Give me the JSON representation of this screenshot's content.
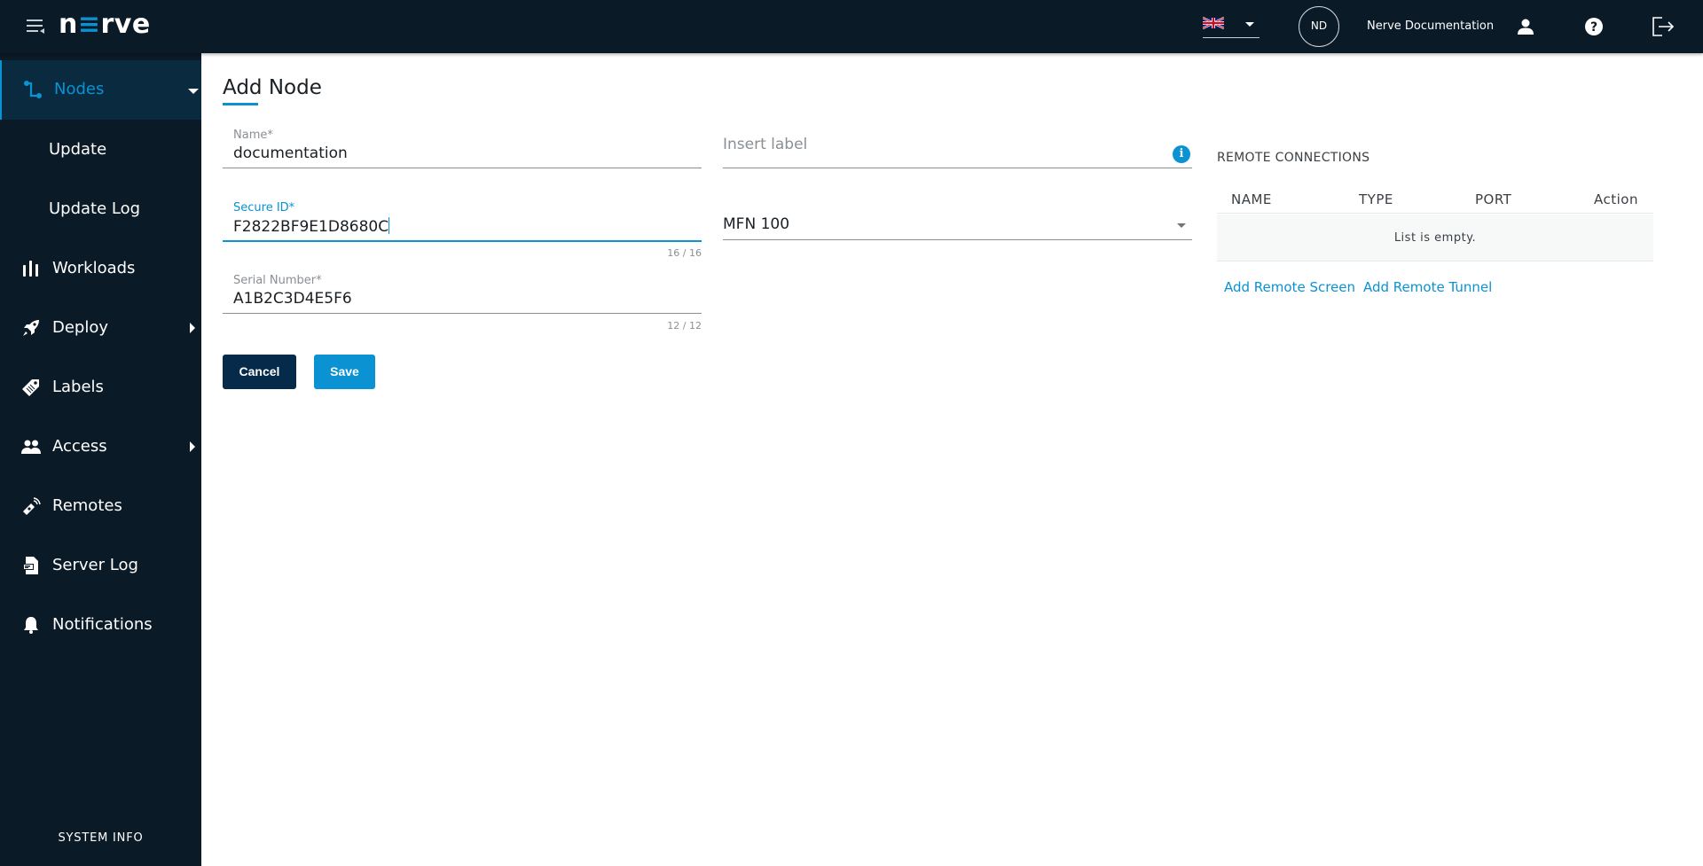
{
  "app": {
    "logo_prefix": "n",
    "logo_accent": "≡",
    "logo_suffix": "rve",
    "brand_color": "#0a92d2",
    "dark_color": "#0b1a27"
  },
  "topbar": {
    "language": "English (UK)",
    "avatar_initials": "ND",
    "username": "Nerve Documentation",
    "icons": [
      "menu-collapse-icon",
      "uk-flag-icon",
      "user-icon",
      "help-icon",
      "logout-icon"
    ]
  },
  "sidebar": {
    "items": [
      {
        "label": "Nodes",
        "icon": "nodes-icon",
        "active": true,
        "expandable": "down"
      },
      {
        "label": "Update",
        "sub": true
      },
      {
        "label": "Update Log",
        "sub": true
      },
      {
        "label": "Workloads",
        "icon": "workloads-icon"
      },
      {
        "label": "Deploy",
        "icon": "rocket-icon",
        "expandable": "right"
      },
      {
        "label": "Labels",
        "icon": "tag-icon"
      },
      {
        "label": "Access",
        "icon": "users-icon",
        "expandable": "right"
      },
      {
        "label": "Remotes",
        "icon": "remote-icon"
      },
      {
        "label": "Server Log",
        "icon": "server-log-icon"
      },
      {
        "label": "Notifications",
        "icon": "bell-icon"
      }
    ],
    "system_info": "SYSTEM INFO"
  },
  "page": {
    "title": "Add Node"
  },
  "form": {
    "name": {
      "label": "Name*",
      "value": "documentation"
    },
    "secure_id": {
      "label": "Secure ID*",
      "value": "F2822BF9E1D8680C",
      "counter": "16 / 16"
    },
    "serial_number": {
      "label": "Serial Number*",
      "value": "A1B2C3D4E5F6",
      "counter": "12 / 12"
    },
    "labels": {
      "placeholder": "Insert label"
    },
    "model": {
      "value": "MFN 100"
    },
    "cancel_label": "Cancel",
    "save_label": "Save"
  },
  "remote_connections": {
    "title": "REMOTE CONNECTIONS",
    "columns": [
      "NAME",
      "TYPE",
      "PORT",
      "Action"
    ],
    "empty_text": "List is empty.",
    "add_screen": "Add Remote Screen",
    "add_tunnel": "Add Remote Tunnel"
  }
}
